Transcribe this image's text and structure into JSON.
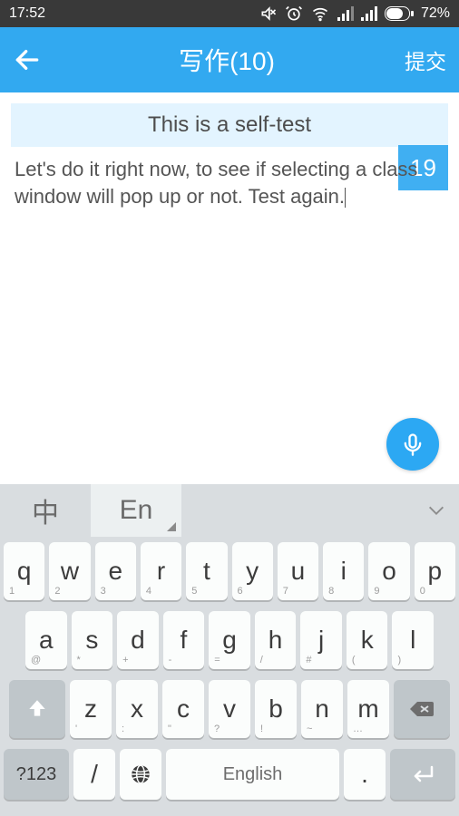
{
  "status": {
    "time": "17:52",
    "battery_pct": "72%"
  },
  "header": {
    "title": "写作(10)",
    "submit": "提交"
  },
  "banner": {
    "text": "This is a self-test"
  },
  "badge": {
    "value": "19"
  },
  "editor": {
    "text": "Let's do it right now, to see if selecting a class window will pop up or not. Test again."
  },
  "keyboard": {
    "lang_cn": "中",
    "lang_en": "En",
    "row1": [
      {
        "k": "q",
        "l": "1"
      },
      {
        "k": "w",
        "l": "2"
      },
      {
        "k": "e",
        "l": "3"
      },
      {
        "k": "r",
        "l": "4"
      },
      {
        "k": "t",
        "l": "5"
      },
      {
        "k": "y",
        "l": "6"
      },
      {
        "k": "u",
        "l": "7"
      },
      {
        "k": "i",
        "l": "8"
      },
      {
        "k": "o",
        "l": "9"
      },
      {
        "k": "p",
        "l": "0"
      }
    ],
    "row2": [
      {
        "k": "a",
        "l": "@"
      },
      {
        "k": "s",
        "l": "*"
      },
      {
        "k": "d",
        "l": "+"
      },
      {
        "k": "f",
        "l": "-"
      },
      {
        "k": "g",
        "l": "="
      },
      {
        "k": "h",
        "l": "/"
      },
      {
        "k": "j",
        "l": "#"
      },
      {
        "k": "k",
        "l": "("
      },
      {
        "k": "l",
        "l": ")"
      }
    ],
    "row3": [
      {
        "k": "z",
        "l": "'"
      },
      {
        "k": "x",
        "l": ":"
      },
      {
        "k": "c",
        "l": "\""
      },
      {
        "k": "v",
        "l": "?"
      },
      {
        "k": "b",
        "l": "!"
      },
      {
        "k": "n",
        "l": "~"
      },
      {
        "k": "m",
        "l": "…"
      }
    ],
    "sym": "?123",
    "slash": "/",
    "space": "English",
    "period": "."
  }
}
